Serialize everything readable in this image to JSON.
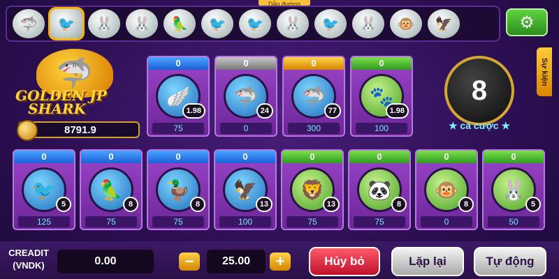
{
  "header": {
    "route_label": "Dẫn đường",
    "history": [
      "shark",
      "bird",
      "rabbit",
      "rabbit",
      "parrot",
      "bird",
      "bird",
      "rabbit",
      "bird",
      "rabbit",
      "monkey",
      "eagle"
    ],
    "settings_icon": "gear-icon"
  },
  "event_tab": "Sự kiện",
  "jackpot": {
    "title_line1": "GOLDEN JP",
    "title_line2": "SHARK",
    "value": "8791.9"
  },
  "timer": {
    "value": "8",
    "label": "★ cá cược ★"
  },
  "top_cards": [
    {
      "count": "0",
      "multiplier": "1.98",
      "amount": "75",
      "color": "blue",
      "icon": "wing"
    },
    {
      "count": "0",
      "multiplier": "24",
      "amount": "0",
      "color": "gray",
      "icon": "silver-shark"
    },
    {
      "count": "0",
      "multiplier": "77",
      "amount": "300",
      "color": "yellow",
      "icon": "gold-shark"
    },
    {
      "count": "0",
      "multiplier": "1.98",
      "amount": "100",
      "color": "green",
      "icon": "paw"
    }
  ],
  "bottom_cards": [
    {
      "count": "0",
      "multiplier": "5",
      "amount": "125",
      "color": "blue",
      "icon": "bird"
    },
    {
      "count": "0",
      "multiplier": "8",
      "amount": "75",
      "color": "blue",
      "icon": "parrot"
    },
    {
      "count": "0",
      "multiplier": "8",
      "amount": "75",
      "color": "blue",
      "icon": "duck"
    },
    {
      "count": "0",
      "multiplier": "13",
      "amount": "100",
      "color": "blue",
      "icon": "eagle"
    },
    {
      "count": "0",
      "multiplier": "13",
      "amount": "75",
      "color": "green",
      "icon": "lion"
    },
    {
      "count": "0",
      "multiplier": "8",
      "amount": "75",
      "color": "green",
      "icon": "panda"
    },
    {
      "count": "0",
      "multiplier": "8",
      "amount": "0",
      "color": "green",
      "icon": "monkey"
    },
    {
      "count": "0",
      "multiplier": "5",
      "amount": "50",
      "color": "green",
      "icon": "rabbit"
    }
  ],
  "controls": {
    "credit_label": "CREADIT\n(VNDK)",
    "credit_value": "0.00",
    "bet_value": "25.00",
    "minus": "−",
    "plus": "+",
    "cancel": "Hủy bỏ",
    "repeat": "Lặp lại",
    "auto": "Tự động"
  }
}
